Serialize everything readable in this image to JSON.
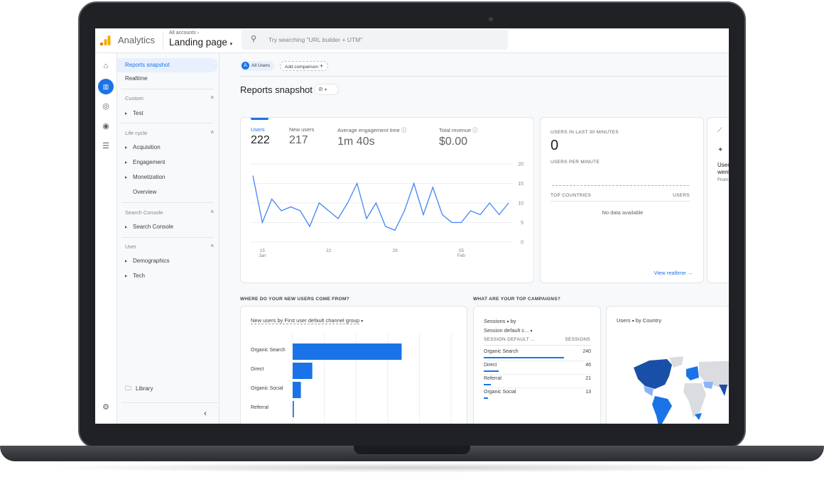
{
  "app": {
    "name": "Analytics",
    "account_crumb": "All accounts",
    "property": "Landing page",
    "search_placeholder": "Try searching \"URL builder + UTM\""
  },
  "colors": {
    "accent": "#1a73e8",
    "logo_orange": "#f9ab00",
    "logo_dark_orange": "#e37400",
    "map_dark": "#1a4fa8",
    "map_mid": "#1a73e8",
    "map_light": "#8ab4f8",
    "map_none": "#dadce0"
  },
  "rail": {
    "icons": [
      "home-icon",
      "reports-icon",
      "explore-icon",
      "advertising-icon",
      "list-icon",
      "settings-icon"
    ]
  },
  "sidebar": {
    "top": [
      {
        "label": "Reports snapshot",
        "active": true
      },
      {
        "label": "Realtime"
      }
    ],
    "sections": [
      {
        "title": "Custom",
        "items": [
          {
            "label": "Test",
            "expandable": true
          }
        ]
      },
      {
        "title": "Life cycle",
        "items": [
          {
            "label": "Acquisition",
            "expandable": true
          },
          {
            "label": "Engagement",
            "expandable": true
          },
          {
            "label": "Monetization",
            "expandable": true
          },
          {
            "label": "Overview",
            "expandable": false
          }
        ]
      },
      {
        "title": "Search Console",
        "items": [
          {
            "label": "Search Console",
            "expandable": true
          }
        ]
      },
      {
        "title": "User",
        "items": [
          {
            "label": "Demographics",
            "expandable": true
          },
          {
            "label": "Tech",
            "expandable": true
          }
        ]
      }
    ],
    "library": "Library"
  },
  "compare": {
    "segment_letter": "A",
    "segment": "All Users",
    "add": "Add comparison"
  },
  "page_title": "Reports snapshot",
  "metrics": [
    {
      "label": "Users",
      "value": "222",
      "active": true
    },
    {
      "label": "New users",
      "value": "217"
    },
    {
      "label": "Average engagement time",
      "value": "1m 40s",
      "help": true
    },
    {
      "label": "Total revenue",
      "value": "$0.00",
      "help": true
    }
  ],
  "chart_data": [
    {
      "type": "line",
      "x": [
        "Jan 14",
        "Jan 15",
        "Jan 16",
        "Jan 17",
        "Jan 18",
        "Jan 19",
        "Jan 20",
        "Jan 21",
        "Jan 22",
        "Jan 23",
        "Jan 24",
        "Jan 25",
        "Jan 26",
        "Jan 27",
        "Jan 28",
        "Jan 29",
        "Jan 30",
        "Jan 31",
        "Feb 01",
        "Feb 02",
        "Feb 03",
        "Feb 04",
        "Feb 05",
        "Feb 06",
        "Feb 07",
        "Feb 08",
        "Feb 09",
        "Feb 10"
      ],
      "series": [
        {
          "values": [
            17,
            5,
            11,
            8,
            9,
            8,
            4,
            10,
            8,
            6,
            10,
            15,
            6,
            10,
            4,
            3,
            8,
            15,
            7,
            14,
            7,
            5,
            5,
            8,
            7,
            10,
            7,
            10
          ]
        }
      ],
      "x_ticks": [
        {
          "day": "15",
          "month": "Jan",
          "index": 1
        },
        {
          "day": "22",
          "month": "",
          "index": 8
        },
        {
          "day": "29",
          "month": "",
          "index": 15
        },
        {
          "day": "05",
          "month": "Feb",
          "index": 22
        }
      ],
      "y_ticks": [
        "20",
        "15",
        "10",
        "5",
        "0"
      ],
      "ylim": [
        0,
        20
      ],
      "grid": true,
      "color": "#4285f4"
    },
    {
      "type": "bar",
      "orientation": "horizontal",
      "title": "New users by First user default channel group",
      "categories": [
        "Organic Search",
        "Direct",
        "Organic Social",
        "Referral"
      ],
      "values": [
        172,
        31,
        13,
        2
      ],
      "xlim": [
        0,
        250
      ],
      "grid": true,
      "color": "#1a73e8"
    }
  ],
  "realtime": {
    "title": "USERS IN LAST 30 MINUTES",
    "value": "0",
    "per_minute": "USERS PER MINUTE",
    "col_country": "TOP COUNTRIES",
    "col_users": "USERS",
    "empty": "No data available",
    "link": "View realtime"
  },
  "insights": {
    "line1": "User",
    "line2": "were",
    "line3": "From"
  },
  "sections": {
    "new_users": "WHERE DO YOUR NEW USERS COME FROM?",
    "campaigns": "WHAT ARE YOUR TOP CAMPAIGNS?"
  },
  "campaigns": {
    "metric": "Sessions",
    "by": "by",
    "dimension": "Session default c...",
    "col_dim": "SESSION DEFAULT ...",
    "col_val": "SESSIONS",
    "rows": [
      {
        "label": "Organic Search",
        "value": "240",
        "share": 1
      },
      {
        "label": "Direct",
        "value": "46",
        "share": 0.19
      },
      {
        "label": "Referral",
        "value": "21",
        "share": 0.09
      },
      {
        "label": "Organic Social",
        "value": "13",
        "share": 0.05
      }
    ]
  },
  "map": {
    "metric": "Users",
    "by": "by Country"
  }
}
